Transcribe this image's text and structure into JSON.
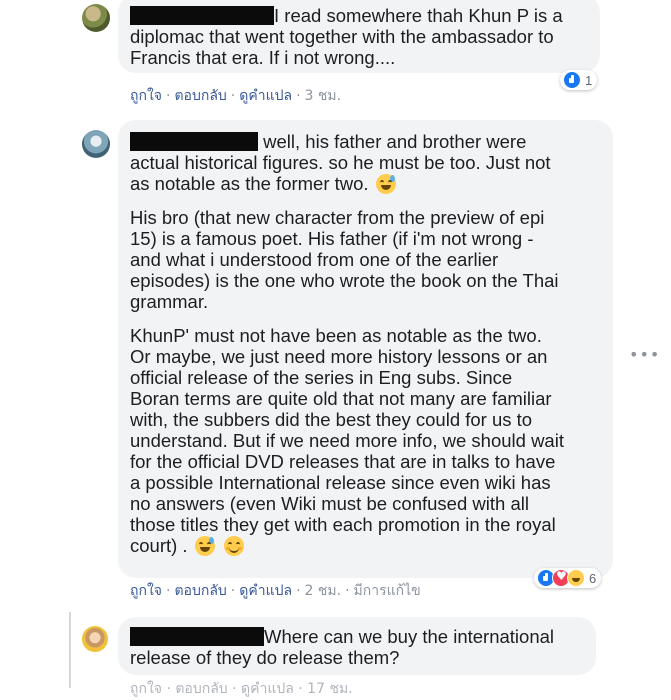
{
  "comments": [
    {
      "text": "I read somewhere thah Khun P is a diplomac that went together with the ambassador to Francis that era. If i not wrong....",
      "lines": [
        "I read somewhere thah Khun P is a",
        "diplomac that went together with the ambassador to",
        "Francis that era. If i not wrong...."
      ],
      "actions": {
        "like": "ถูกใจ",
        "reply": "ตอบกลับ",
        "translate": "ดูคำแปล",
        "time": "3 ชม."
      },
      "reactions": {
        "icons": [
          "like-icon"
        ],
        "count": "1"
      }
    },
    {
      "paragraphs": [
        {
          "lines": [
            "well, his father and brother were",
            "actual historical figures. so he must be too. Just not",
            "as notable as the former two."
          ]
        },
        {
          "lines": [
            "His bro (that new character from the preview of epi",
            "15) is a famous poet. His father (if i'm not wrong -",
            "and what i understood from one of the earlier",
            "episodes) is the one who wrote the book on the Thai",
            "grammar."
          ]
        },
        {
          "lines": [
            "KhunP' must not have been as notable as the two.",
            "Or maybe, we just need more history lessons or an",
            "official release of the series in Eng subs. Since",
            "Boran terms are quite old that not many are familiar",
            "with, the subbers did the best they could for us to",
            "understand. But if we need more info, we should wait",
            "for the official DVD releases that are in talks to have",
            "a possible International release since even wiki has",
            "no answers (even Wiki must be confused with all",
            "those titles they get with each promotion in the royal",
            "court) ."
          ]
        }
      ],
      "actions": {
        "like": "ถูกใจ",
        "reply": "ตอบกลับ",
        "translate": "ดูคำแปล",
        "time": "2 ชม.",
        "edited": "มีการแก้ไข"
      },
      "reactions": {
        "icons": [
          "like-icon",
          "love-icon",
          "haha-icon"
        ],
        "count": "6"
      },
      "emoji": [
        "sweat-smile-icon",
        "smiling-face-icon"
      ]
    },
    {
      "lines": [
        "Where can we buy the international",
        "release of they do release them?"
      ],
      "cut_actions": "ถูกใจ · ตอบกลับ · ดูคำแปล · 17 ชม."
    }
  ],
  "more_icon": "•••",
  "colors": {
    "bubble": "#f2f3f5",
    "link": "#385898",
    "meta": "#8d949e",
    "like": "#1877f2",
    "love": "#f33e58",
    "haha": "#ffcc4d"
  }
}
